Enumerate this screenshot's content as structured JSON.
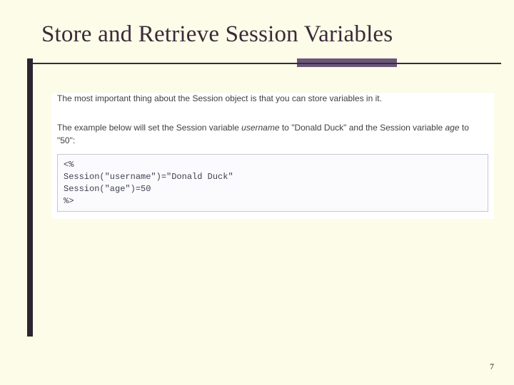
{
  "title": "Store and Retrieve Session Variables",
  "para1_a": "The most important thing about the Session object is that you can store variables in it.",
  "para2_a": "The example below will set the Session variable ",
  "para2_i1": "username",
  "para2_b": " to \"Donald Duck\" and the Session variable ",
  "para2_i2": "age",
  "para2_c": " to \"50\":",
  "code": "<%\nSession(\"username\")=\"Donald Duck\"\nSession(\"age\")=50\n%>",
  "page_number": "7"
}
